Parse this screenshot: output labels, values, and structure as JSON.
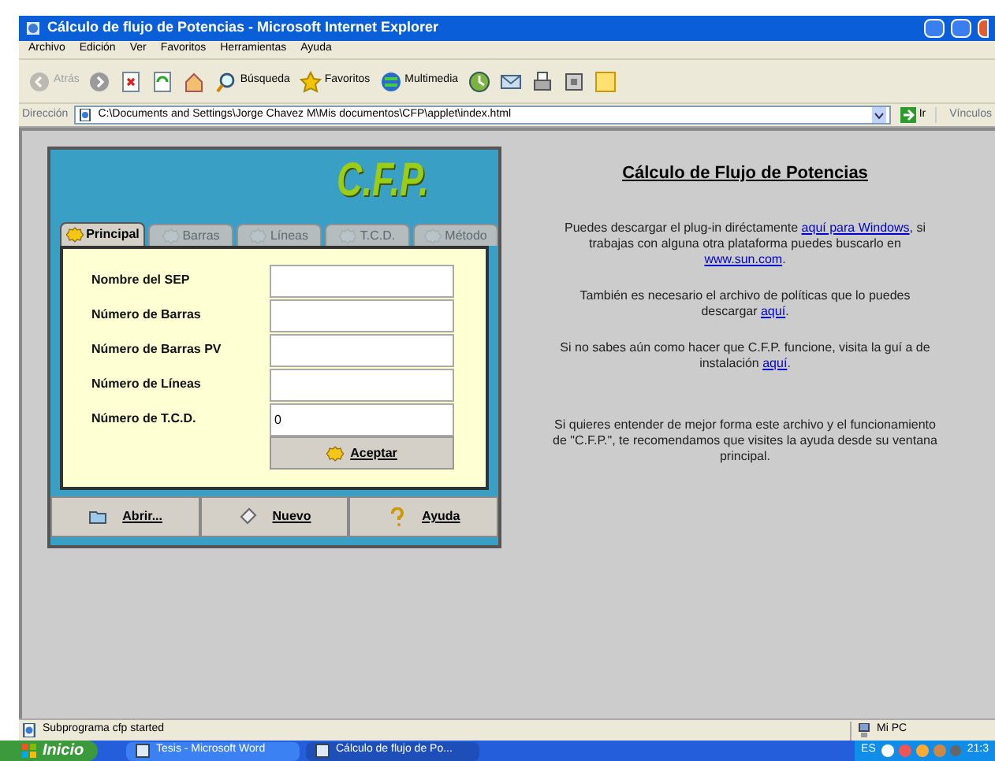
{
  "window": {
    "title": "Cálculo de flujo de Potencias - Microsoft Internet Explorer"
  },
  "menu": [
    "Archivo",
    "Edición",
    "Ver",
    "Favoritos",
    "Herramientas",
    "Ayuda"
  ],
  "toolbar": [
    {
      "kind": "back",
      "label": "Atrás",
      "disabled": true
    },
    {
      "kind": "forward",
      "disabled": false
    },
    {
      "kind": "stop"
    },
    {
      "kind": "refresh"
    },
    {
      "kind": "home"
    },
    {
      "kind": "search",
      "label": "Búsqueda"
    },
    {
      "kind": "favorites",
      "label": "Favoritos"
    },
    {
      "kind": "media",
      "label": "Multimedia"
    },
    {
      "kind": "history"
    },
    {
      "kind": "mail"
    },
    {
      "kind": "print"
    },
    {
      "kind": "edit"
    },
    {
      "kind": "note"
    }
  ],
  "address": {
    "label": "Dirección",
    "value": "C:\\Documents and Settings\\Jorge Chavez M\\Mis documentos\\CFP\\applet\\index.html",
    "go": "Ir",
    "links": "Vínculos"
  },
  "applet": {
    "logo": "C.F.P.",
    "tabs": [
      {
        "label": "Principal",
        "selected": true,
        "disabled": false
      },
      {
        "label": "Barras",
        "selected": false,
        "disabled": true
      },
      {
        "label": "Líneas",
        "selected": false,
        "disabled": true
      },
      {
        "label": "T.C.D.",
        "selected": false,
        "disabled": true
      },
      {
        "label": "Método",
        "selected": false,
        "disabled": true
      }
    ],
    "fields": [
      {
        "label": "Nombre del SEP"
      },
      {
        "label": "Número de Barras"
      },
      {
        "label": "Número de Barras PV"
      },
      {
        "label": "Número de Líneas"
      },
      {
        "label": "Número de T.C.D.",
        "value": "0"
      }
    ],
    "accept": "Aceptar",
    "buttons": [
      {
        "kind": "open",
        "label": "Abrir..."
      },
      {
        "kind": "new",
        "label": "Nuevo"
      },
      {
        "kind": "help",
        "label": "Ayuda"
      }
    ]
  },
  "info": {
    "title": "Cálculo de Flujo de Potencias",
    "paragraphs": [
      [
        {
          "kind": "text",
          "text": "Puedes descargar el plug-in diréctamente "
        },
        {
          "kind": "link",
          "text": "aquí para Windows"
        },
        {
          "kind": "text",
          "text": ", si trabajas con alguna otra plataforma puedes buscarlo en "
        },
        {
          "kind": "link",
          "text": "www.sun.com"
        },
        {
          "kind": "text",
          "text": "."
        }
      ],
      [
        {
          "kind": "text",
          "text": "También es necesario el archivo de políticas que lo puedes descargar "
        },
        {
          "kind": "link",
          "text": "aquí"
        },
        {
          "kind": "text",
          "text": "."
        }
      ],
      [
        {
          "kind": "text",
          "text": "Si no sabes aún como hacer que C.F.P. funcione, visita la guí a de instalación "
        },
        {
          "kind": "link",
          "text": "aquí"
        },
        {
          "kind": "text",
          "text": "."
        }
      ],
      [
        {
          "kind": "text",
          "text": "Si quieres entender de mejor forma este archivo y el funcionamiento de \"C.F.P.\", te recomendamos que visites la ayuda desde su ventana principal."
        }
      ]
    ]
  },
  "status_bar": {
    "text": "Subprograma cfp started",
    "zone": "Mi PC"
  },
  "taskbar": {
    "start": "Inicio",
    "tasks": [
      {
        "label": "Tesis - Microsoft Word",
        "selected": false
      },
      {
        "label": "Cálculo de flujo de Po...",
        "selected": true
      }
    ],
    "language": "ES",
    "clock": "21:3"
  }
}
